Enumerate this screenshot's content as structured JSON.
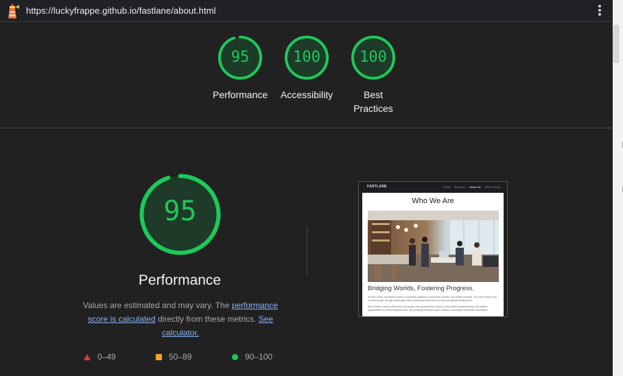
{
  "toolbar": {
    "url": "https://luckyfrappe.github.io/fastlane/about.html",
    "logo_icon": "lighthouse-icon",
    "menu_icon": "kebab-menu-icon"
  },
  "summary": [
    {
      "score": "95",
      "label": "Performance"
    },
    {
      "score": "100",
      "label": "Accessibility"
    },
    {
      "score": "100",
      "label": "Best Practices"
    }
  ],
  "performance": {
    "score": "95",
    "score_fraction": 0.95,
    "title": "Performance",
    "desc_prefix": "Values are estimated and may vary. The ",
    "link1": "performance score is calculated",
    "desc_middle": " directly from these metrics. ",
    "link2": "See calculator.",
    "legend": [
      {
        "shape": "triangle",
        "range": "0–49",
        "color": "#e53935"
      },
      {
        "shape": "square",
        "range": "50–89",
        "color": "#f4a623"
      },
      {
        "shape": "circle",
        "range": "90–100",
        "color": "#1cc95a"
      }
    ]
  },
  "thumbnail": {
    "brand": "FASTLANE",
    "nav": [
      "Home",
      "Services",
      "About Us",
      "Get in Touch"
    ],
    "heading": "Who We Are",
    "subheading": "Bridging Worlds, Fostering Progress.",
    "para1": "At FASTLANE, we believe travel is a powerful catalyst for connection, growth, and positive change. Our core mission is to connect people through meaningful travel experiences that drive personal and global development.",
    "para2": "We envision a world where every trip sparks new perspectives, fosters cross-cultural understanding, and creates opportunities for shared advancement. By providing seamless travel solutions, we enable individuals, businesses"
  },
  "colors": {
    "pass": "#1cc95a",
    "pass_bg": "#1e3a28",
    "link": "#8ab4f8",
    "background": "#212121"
  }
}
